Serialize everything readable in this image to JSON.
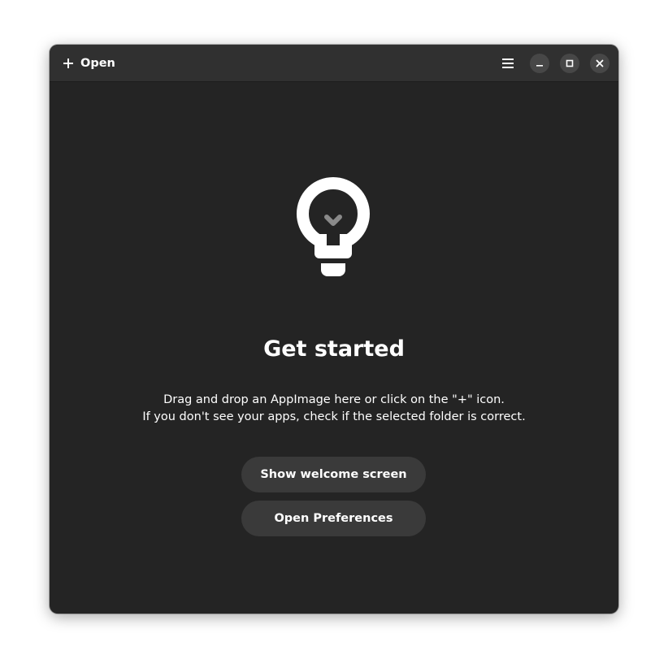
{
  "headerbar": {
    "open_label": "Open",
    "icons": {
      "open": "plus-icon",
      "menu": "hamburger-menu-icon",
      "minimize": "minimize-icon",
      "maximize": "maximize-icon",
      "close": "close-icon"
    }
  },
  "status_page": {
    "icon": "lightbulb-icon",
    "title": "Get started",
    "description_line_1": "Drag and drop an AppImage here or click on the \"+\" icon.",
    "description_line_2": "If you don't see your apps, check if the selected folder is correct."
  },
  "actions": {
    "welcome_label": "Show welcome screen",
    "preferences_label": "Open Preferences"
  },
  "colors": {
    "window_bg": "#242424",
    "headerbar_bg": "#303030",
    "button_bg": "#3a3a3a",
    "window_control_bg": "#474747",
    "text": "#ffffff"
  }
}
